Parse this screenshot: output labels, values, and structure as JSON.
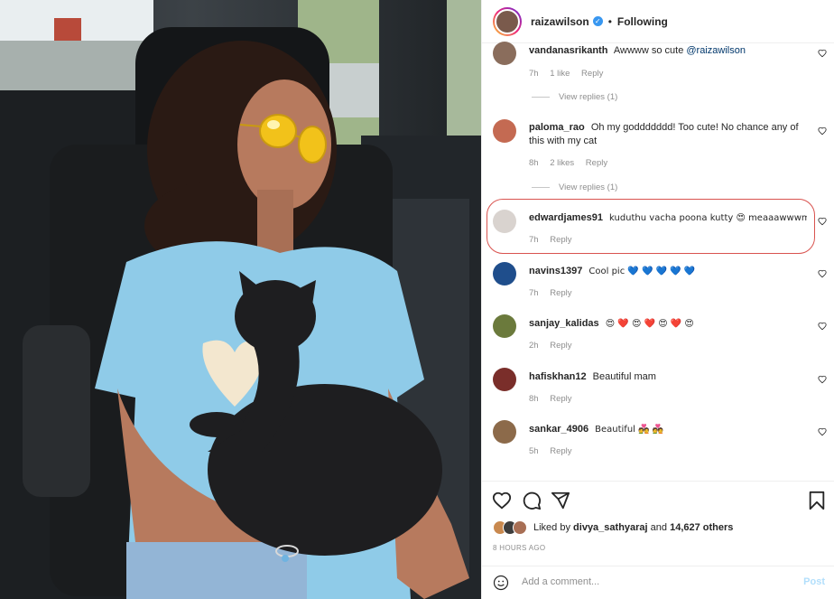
{
  "post": {
    "username": "raizawilson",
    "separator": "•",
    "follow_state": "Following"
  },
  "comments": [
    {
      "user": "vandanasrikanth",
      "text": "Awwww so cute",
      "mention": "@raizawilson",
      "time": "7h",
      "likes": "1 like",
      "reply": "Reply",
      "view_replies": "View replies (1)",
      "avatar_color": "#8a6d5c"
    },
    {
      "user": "paloma_rao",
      "text": "Oh my goddddddd! Too cute! No chance any of this with my cat",
      "time": "8h",
      "likes": "2 likes",
      "reply": "Reply",
      "view_replies": "View replies (1)",
      "avatar_color": "#c46a52"
    },
    {
      "user": "edwardjames91",
      "text": "kuduthu vacha poona kutty 😍 meaaawwwm...",
      "time": "7h",
      "reply": "Reply",
      "avatar_color": "#d9d3cf"
    },
    {
      "user": "navins1397",
      "text": "Cool pic 💙 💙 💙 💙 💙",
      "time": "7h",
      "reply": "Reply",
      "avatar_color": "#1f4e8c"
    },
    {
      "user": "sanjay_kalidas",
      "text": "😍 ❤️ 😍 ❤️ 😍 ❤️ 😍",
      "time": "2h",
      "reply": "Reply",
      "avatar_color": "#6b7a3c"
    },
    {
      "user": "hafiskhan12",
      "text": "Beautiful mam",
      "time": "8h",
      "reply": "Reply",
      "avatar_color": "#7a2e2a"
    },
    {
      "user": "sankar_4906",
      "text": "Beautiful 💑 💑",
      "time": "5h",
      "reply": "Reply",
      "avatar_color": "#8c6a4a"
    }
  ],
  "likes": {
    "prefix": "Liked by",
    "user": "divya_sathyaraj",
    "and": "and",
    "count": "14,627 others"
  },
  "time_ago": "8 HOURS AGO",
  "add_comment": {
    "placeholder": "Add a comment...",
    "post_label": "Post"
  },
  "icons": [
    "heart-icon",
    "comment-icon",
    "share-icon",
    "bookmark-icon",
    "emoji-icon",
    "verified-icon"
  ],
  "colors": {
    "verified": "#3897f0",
    "highlight_border": "#d9534f",
    "post_button": "#b2dffc",
    "mention": "#00376b"
  }
}
